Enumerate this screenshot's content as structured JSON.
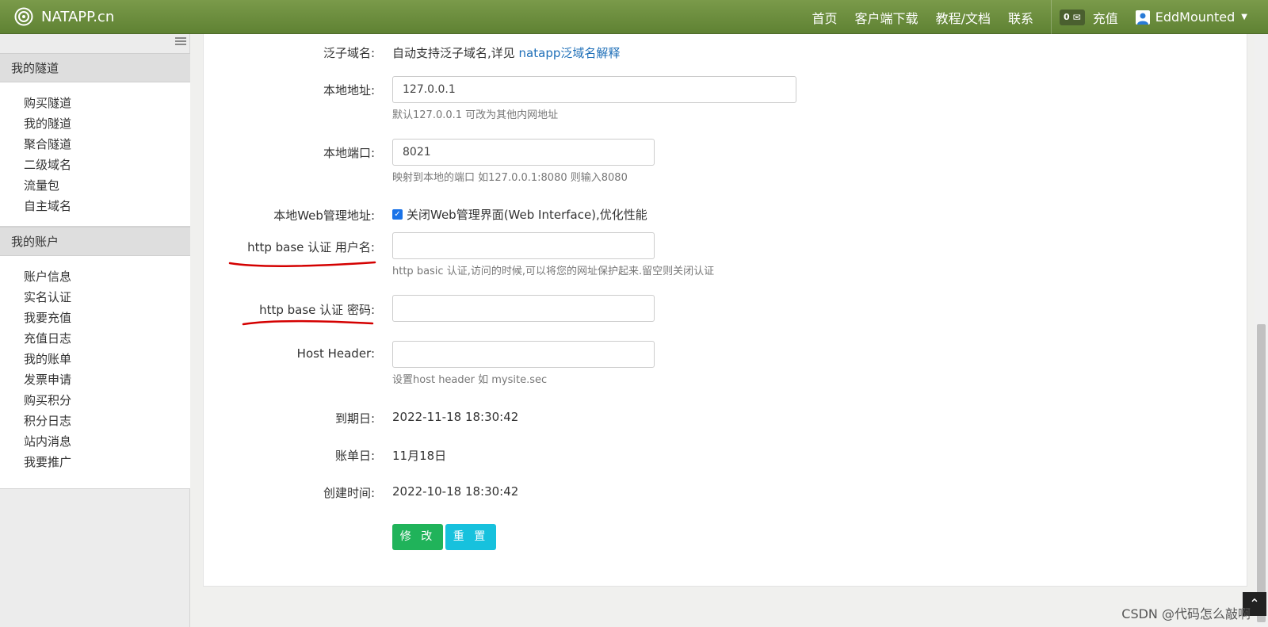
{
  "header": {
    "logo_text": "NATAPP.cn",
    "nav": [
      "首页",
      "客户端下载",
      "教程/文档",
      "联系"
    ],
    "badge_count": "0",
    "recharge": "充值",
    "username": "EddMounted"
  },
  "sidebar": {
    "sections": [
      {
        "title": "我的隧道",
        "items": [
          "购买隧道",
          "我的隧道",
          "聚合隧道",
          "二级域名",
          "流量包",
          "自主域名"
        ]
      },
      {
        "title": "我的账户",
        "items": [
          "账户信息",
          "实名认证",
          "我要充值",
          "充值日志",
          "我的账单",
          "发票申请",
          "购买积分",
          "积分日志",
          "站内消息",
          "我要推广"
        ]
      }
    ]
  },
  "form": {
    "wildcard": {
      "label": "泛子域名:",
      "text": "自动支持泛子域名,详见 ",
      "link": "natapp泛域名解释"
    },
    "local_addr": {
      "label": "本地地址:",
      "value": "127.0.0.1",
      "help": "默认127.0.0.1 可改为其他内网地址"
    },
    "local_port": {
      "label": "本地端口:",
      "value": "8021",
      "help": "映射到本地的端口 如127.0.0.1:8080 则输入8080"
    },
    "web_admin": {
      "label": "本地Web管理地址:",
      "checkbox": "关闭Web管理界面(Web Interface),优化性能",
      "checked": true
    },
    "auth_user": {
      "label": "http base 认证 用户名:",
      "value": "",
      "help": "http basic 认证,访问的时候,可以将您的网址保护起来.留空则关闭认证"
    },
    "auth_pass": {
      "label": "http base 认证 密码:",
      "value": ""
    },
    "host_header": {
      "label": "Host Header:",
      "value": "",
      "help": "设置host header 如 mysite.sec"
    },
    "expire": {
      "label": "到期日:",
      "value": "2022-11-18 18:30:42"
    },
    "bill_day": {
      "label": "账单日:",
      "value": "11月18日"
    },
    "created": {
      "label": "创建时间:",
      "value": "2022-10-18 18:30:42"
    },
    "submit": "修 改",
    "reset": "重 置"
  },
  "watermark": "CSDN @代码怎么敲啊"
}
